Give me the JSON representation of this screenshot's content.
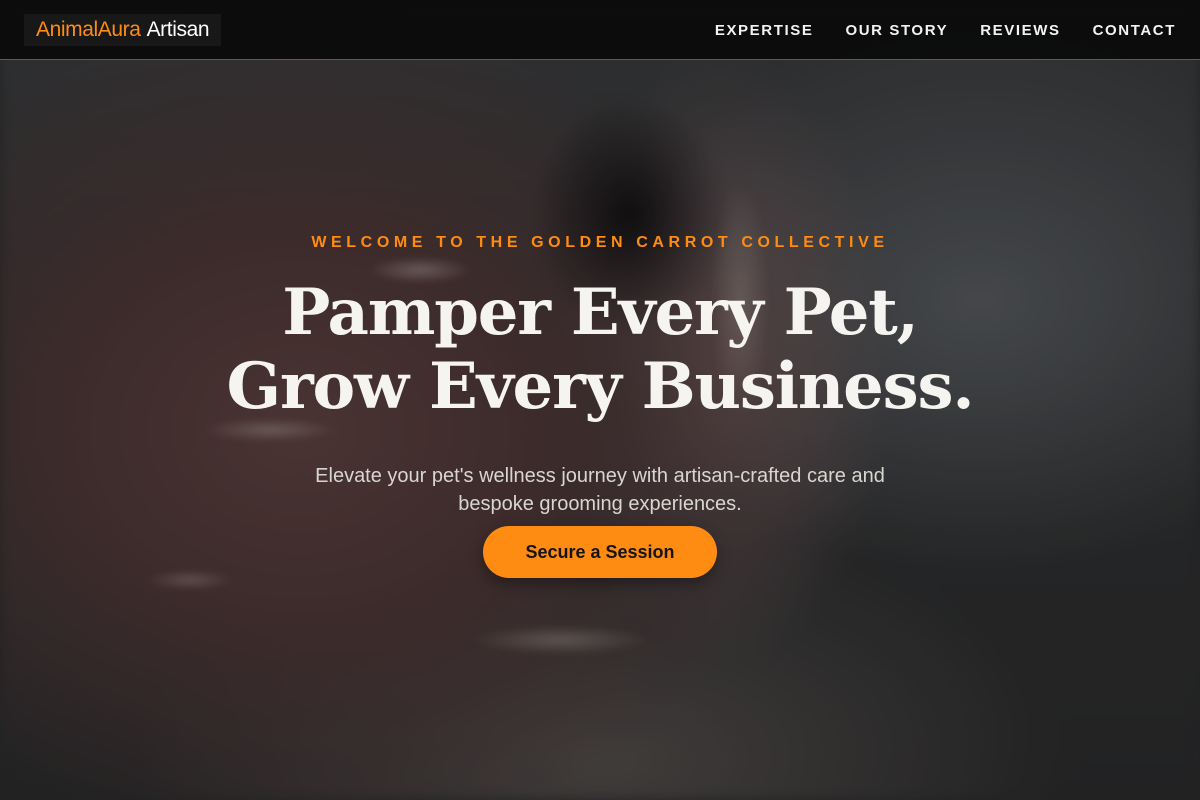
{
  "brand": {
    "name_accent": "AnimalAura",
    "name_rest": "Artisan"
  },
  "nav": {
    "items": [
      {
        "label": "EXPERTISE"
      },
      {
        "label": "OUR STORY"
      },
      {
        "label": "REVIEWS"
      },
      {
        "label": "CONTACT"
      }
    ]
  },
  "hero": {
    "eyebrow": "WELCOME TO THE GOLDEN CARROT COLLECTIVE",
    "headline_line1": "Pamper Every Pet,",
    "headline_line2": "Grow Every Business.",
    "subtitle_line1": "Elevate your pet's wellness journey with artisan-crafted care and",
    "subtitle_line2": "bespoke grooming experiences.",
    "cta_label": "Secure a Session"
  },
  "colors": {
    "accent": "#ff8c12",
    "nav_background": "#0a0a0a",
    "headline_text": "#f6f4f1",
    "body_text": "#d9d6d2"
  }
}
